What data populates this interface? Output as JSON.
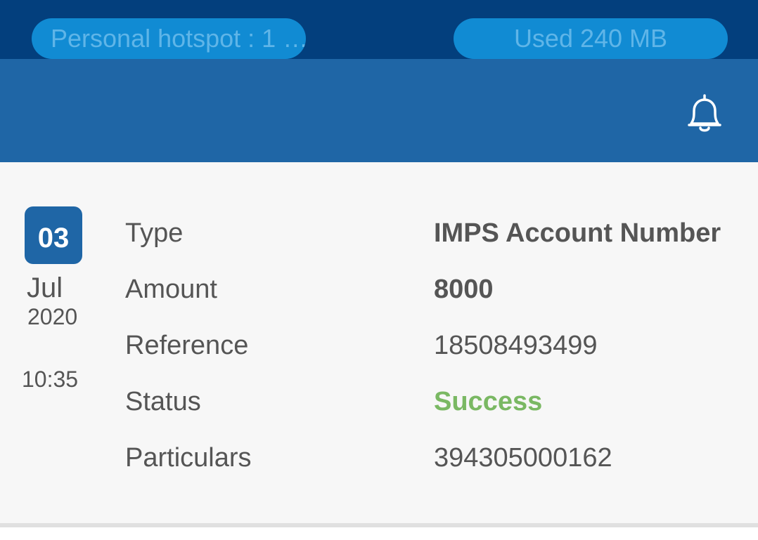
{
  "status_bar": {
    "hotspot_label": "Personal hotspot : 1 …",
    "data_used_prefix": "Used",
    "data_used_value": "240 MB"
  },
  "header": {
    "notification_icon": "bell-icon"
  },
  "transaction": {
    "date": {
      "day": "03",
      "month": "Jul",
      "year": "2020",
      "time": "10:35"
    },
    "fields": {
      "type_label": "Type",
      "type_value": "IMPS Account Number",
      "amount_label": "Amount",
      "amount_value": "8000",
      "reference_label": "Reference",
      "reference_value": "18508493499",
      "status_label": "Status",
      "status_value": "Success",
      "particulars_label": "Particulars",
      "particulars_value": "394305000162"
    }
  },
  "colors": {
    "status_strip": "#033f7d",
    "app_bar": "#1f66a6",
    "pill": "#118bd3",
    "success": "#7ab863",
    "text": "#555555"
  }
}
